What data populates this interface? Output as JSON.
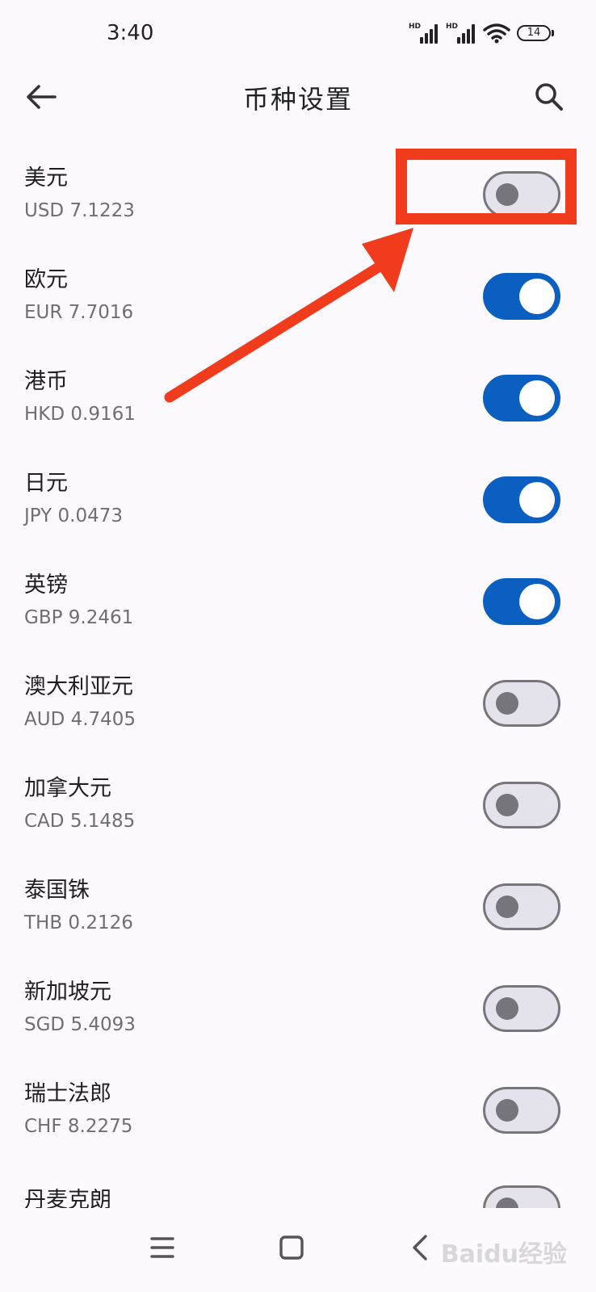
{
  "status_bar": {
    "time": "3:40",
    "signal_1_label": "HD",
    "signal_2_label": "HD",
    "battery": "14"
  },
  "header": {
    "title": "币种设置",
    "back_icon": "arrow-left-icon",
    "search_icon": "search-icon"
  },
  "currencies": [
    {
      "name": "美元",
      "rate": "USD 7.1223",
      "enabled": false
    },
    {
      "name": "欧元",
      "rate": "EUR 7.7016",
      "enabled": true
    },
    {
      "name": "港币",
      "rate": "HKD 0.9161",
      "enabled": true
    },
    {
      "name": "日元",
      "rate": "JPY 0.0473",
      "enabled": true
    },
    {
      "name": "英镑",
      "rate": "GBP 9.2461",
      "enabled": true
    },
    {
      "name": "澳大利亚元",
      "rate": "AUD 4.7405",
      "enabled": false
    },
    {
      "name": "加拿大元",
      "rate": "CAD 5.1485",
      "enabled": false
    },
    {
      "name": "泰国铢",
      "rate": "THB 0.2126",
      "enabled": false
    },
    {
      "name": "新加坡元",
      "rate": "SGD 5.4093",
      "enabled": false
    },
    {
      "name": "瑞士法郎",
      "rate": "CHF 8.2275",
      "enabled": false
    }
  ],
  "partial_row": {
    "name": "丹麦克朗",
    "enabled": false
  },
  "annotation": {
    "color": "#f03c1c"
  },
  "colors": {
    "toggle_on": "#0a5fc1",
    "toggle_off_track": "#e4e3ec",
    "toggle_off_border": "#77767d",
    "background": "#fcfaff"
  },
  "nav_bar": {
    "menu_icon": "menu-icon",
    "home_icon": "home-square-icon",
    "back_icon": "chevron-left-icon"
  },
  "watermark": "Baidu经验"
}
